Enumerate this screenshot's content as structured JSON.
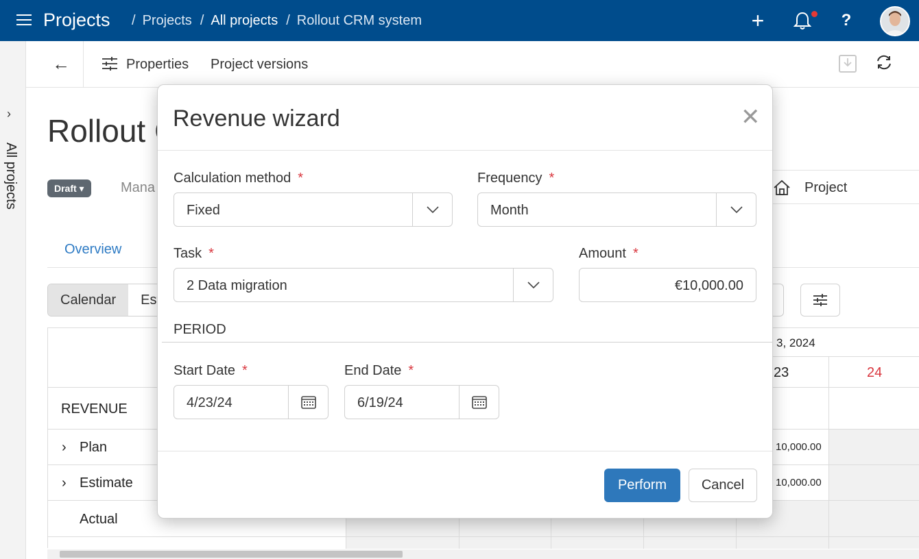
{
  "header": {
    "app_title": "Projects",
    "breadcrumbs": [
      "Projects",
      "All projects",
      "Rollout CRM system"
    ],
    "separator": "/"
  },
  "rail": {
    "label": "All projects"
  },
  "toolbar": {
    "properties_label": "Properties",
    "versions_label": "Project versions"
  },
  "background": {
    "title_partial": "Rollout C",
    "status_badge": "Draft",
    "manager_partial": "Mana",
    "project_label": "Project",
    "tab_overview": "Overview",
    "view_calendar": "Calendar",
    "view_est_partial": "Est",
    "date_header_partial": "3, 2024",
    "day_23": "23",
    "day_24": "24",
    "section_revenue": "REVENUE",
    "rows": [
      "Plan",
      "Estimate",
      "Actual"
    ],
    "plan_value": "10,000.00",
    "estimate_value": "10,000.00"
  },
  "colors": {
    "header_bg": "#004c8c",
    "accent": "#2e78bb",
    "required": "#d9363e",
    "weekend_day": "#d9363e"
  },
  "modal": {
    "title": "Revenue wizard",
    "calc_method_label": "Calculation method",
    "calc_method_value": "Fixed",
    "frequency_label": "Frequency",
    "frequency_value": "Month",
    "task_label": "Task",
    "task_value": "2 Data migration",
    "amount_label": "Amount",
    "amount_value": "€10,000.00",
    "period_section": "PERIOD",
    "start_date_label": "Start Date",
    "start_date_value": "4/23/24",
    "end_date_label": "End Date",
    "end_date_value": "6/19/24",
    "required_mark": "*",
    "perform_label": "Perform",
    "cancel_label": "Cancel"
  }
}
